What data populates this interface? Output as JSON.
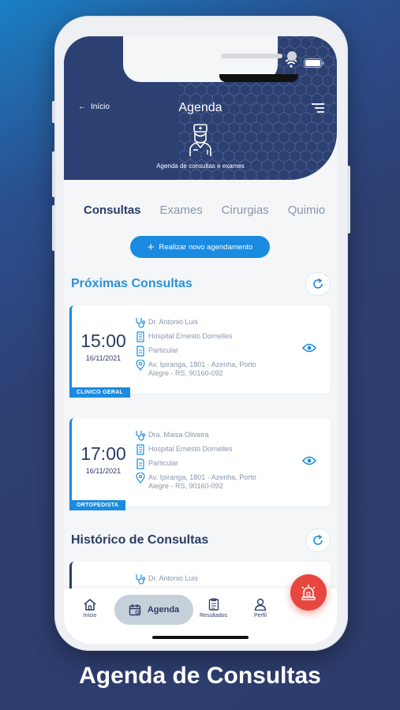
{
  "header": {
    "back_label": "Início",
    "title": "Agenda",
    "subtitle": "Agenda de consultas e exames"
  },
  "tabs": [
    "Consultas",
    "Exames",
    "Cirurgias",
    "Quimio"
  ],
  "new_appointment_label": "Realizar novo agendamento",
  "upcoming": {
    "title": "Próximas Consultas",
    "cards": [
      {
        "time": "15:00",
        "date": "16/11/2021",
        "doctor": "Dr. Antonio Luis",
        "hospital": "Hospital Ernesto Dornelles",
        "plan": "Particular",
        "address": "Av. Ipiranga, 1801 - Azenha, Porto Alegre - RS, 90160-092",
        "specialty": "CLINICO GERAL"
      },
      {
        "time": "17:00",
        "date": "16/11/2021",
        "doctor": "Dra. Maisa Oliveira",
        "hospital": "Hospital Ernesto Dornelles",
        "plan": "Particular",
        "address": "Av. Ipiranga, 1801 - Azenha, Porto Alegre - RS, 90160-092",
        "specialty": "ORTOPEDISTA"
      }
    ]
  },
  "history": {
    "title": "Histórico de Consultas",
    "cards": [
      {
        "doctor": "Dr. Antonio Luis"
      }
    ]
  },
  "bottom_nav": {
    "home": "Início",
    "agenda": "Agenda",
    "results": "Resultados",
    "profile": "Perfil"
  },
  "caption": "Agenda de Consultas",
  "colors": {
    "header_bg": "#2d4072",
    "accent": "#1a8be0",
    "navy_text": "#2b3c66",
    "emergency": "#e8473f"
  }
}
